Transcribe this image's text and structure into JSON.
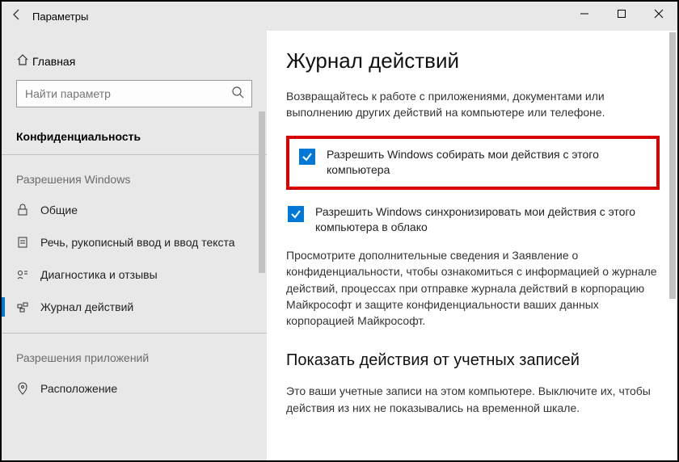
{
  "window": {
    "title": "Параметры"
  },
  "sidebar": {
    "home": "Главная",
    "search_placeholder": "Найти параметр",
    "section": "Конфиденциальность",
    "group1": "Разрешения Windows",
    "items1": [
      {
        "label": "Общие"
      },
      {
        "label": "Речь, рукописный ввод и ввод текста"
      },
      {
        "label": "Диагностика и отзывы"
      },
      {
        "label": "Журнал действий"
      }
    ],
    "group2": "Разрешения приложений",
    "items2": [
      {
        "label": "Расположение"
      }
    ]
  },
  "main": {
    "heading": "Журнал действий",
    "intro": "Возвращайтесь к работе с приложениями, документами или выполнению других действий на компьютере или телефоне.",
    "check1": "Разрешить Windows собирать мои действия с этого компьютера",
    "check2": "Разрешить Windows синхронизировать мои действия с этого компьютера в облако",
    "info": "Просмотрите дополнительные сведения и Заявление о конфиденциальности, чтобы ознакомиться с информацией о журнале действий, процессах при отправке журнала действий в корпорацию Майкрософт и защите конфиденциальности ваших данных корпорацией Майкрософт.",
    "heading2": "Показать действия от учетных записей",
    "accounts_text": "Это ваши учетные записи на этом компьютере. Выключите их, чтобы действия из них не показывались на временной шкале."
  }
}
